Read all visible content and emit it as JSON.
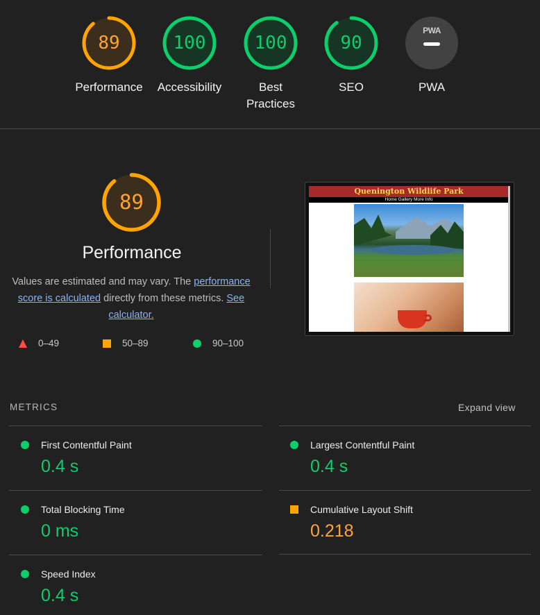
{
  "colors": {
    "pass": "#0cce6b",
    "average": "#ffa400",
    "fail": "#ff4e42",
    "pass_text": "#0cce6b",
    "average_text": "#ffa336",
    "pwa_bg": "#424242"
  },
  "categories": [
    {
      "label": "Performance",
      "score": "89",
      "value": 0.89,
      "rating": "average"
    },
    {
      "label": "Accessibility",
      "score": "100",
      "value": 1.0,
      "rating": "pass"
    },
    {
      "label": "Best Practices",
      "score": "100",
      "value": 1.0,
      "rating": "pass"
    },
    {
      "label": "SEO",
      "score": "90",
      "value": 0.9,
      "rating": "pass"
    },
    {
      "label": "PWA",
      "badge": "PWA",
      "rating": "na"
    }
  ],
  "performance": {
    "score": "89",
    "value": 0.89,
    "title": "Performance",
    "desc_prefix": "Values are estimated and may vary. The ",
    "desc_link1": "performance score is calculated",
    "desc_middle": " directly from these metrics. ",
    "desc_link2": "See calculator.",
    "legend": [
      {
        "range": "0–49",
        "icon": "triangle-icon"
      },
      {
        "range": "50–89",
        "icon": "square-icon"
      },
      {
        "range": "90–100",
        "icon": "circle-icon"
      }
    ]
  },
  "screenshot": {
    "site_title": "Quenington Wildlife Park",
    "nav": "Home  Gallery  More Info"
  },
  "metrics": {
    "heading": "METRICS",
    "expand_label": "Expand view",
    "items": [
      {
        "label": "First Contentful Paint",
        "value": "0.4 s",
        "rating": "pass"
      },
      {
        "label": "Largest Contentful Paint",
        "value": "0.4 s",
        "rating": "pass"
      },
      {
        "label": "Total Blocking Time",
        "value": "0 ms",
        "rating": "pass"
      },
      {
        "label": "Cumulative Layout Shift",
        "value": "0.218",
        "rating": "average"
      },
      {
        "label": "Speed Index",
        "value": "0.4 s",
        "rating": "pass"
      }
    ]
  }
}
